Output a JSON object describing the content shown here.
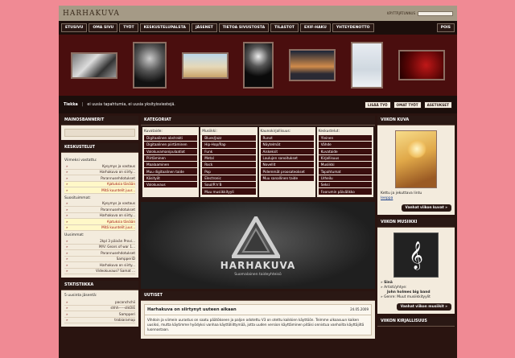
{
  "site": {
    "logo": "HARHAKUVA",
    "login_label": "KÄYTTÄJÄTUNNUS"
  },
  "nav": {
    "items": [
      "ETUSIVU",
      "OMA SIVU",
      "TYÖT",
      "KESKUSTELUPALSTA",
      "JÄSENET",
      "TIETOA SIVUSTOSTA",
      "TILASTOT",
      "EXIF-HAKU",
      "YHTEYDENOTTO"
    ],
    "right": "POIS"
  },
  "info": {
    "day": "Tiekka",
    "text": "ei uusia tapahtumia, ei uusia yksityisviestejä.",
    "buttons": [
      "LISÄÄ TYÖ",
      "OMAT TYÖT",
      "ASETUKSET"
    ]
  },
  "left": {
    "banner_title": "MAINOSBANNERIT",
    "forum_title": "KESKUSTELUT",
    "recent_label": "Viimeksi vastattu:",
    "recent": [
      "Kysymys ja vastaus",
      "Harhakuva on siirty...",
      "Parannusehdotukset",
      "Ajatuksia tänään",
      "Mitä kuuntelit juur..."
    ],
    "popular_label": "Suosituimmat:",
    "popular": [
      "Kysymys ja vastaus",
      "Parannusehdotukset",
      "Harhakuva on siirty...",
      "Ajatuksia tänään",
      "Mitä kuuntelit juur..."
    ],
    "newest_label": "Uusimmat:",
    "newest": [
      "2kpl 3 päivän Provi...",
      "M/V: Gears of war 1...",
      "Parannusehdotukset",
      "SampperiD",
      "Harhakuva on siirty...",
      "Videokuvaus? Samat ..."
    ],
    "stats_title": "STATISTIIKKA",
    "stats_label": "5 uusinta jäsentä:",
    "members": [
      "pacanchchii",
      "shhh-----sIkOiE",
      "Sampperi",
      "trobiaramap"
    ]
  },
  "mid": {
    "cat_title": "KATEGORIAT",
    "cats": [
      {
        "head": "Kuvataide:",
        "items": [
          "Digitaalinen abstrakti",
          "Digitaalinen piirtäminen",
          "Valokuvamanipulaatiot",
          "Piirtäminen",
          "Maalaaminen",
          "Muu digitaalinen taide",
          "Käsityöt",
          "Valokuvaus"
        ]
      },
      {
        "head": "Musiikki:",
        "items": [
          "Blues/Jazz",
          "Hip-Hop/Rap",
          "Funk",
          "Metal",
          "Rock",
          "Pop",
          "Electronic",
          "Soul/R'n'B",
          "Muu musiikkityyli"
        ]
      },
      {
        "head": "Kaunokirjallisuus:",
        "items": [
          "Runot",
          "Näytelmät",
          "Aiskeksit",
          "Laulujen sanoitukset",
          "Novellit",
          "Pidemmät proosateokset",
          "Muu sanallinen taide"
        ]
      },
      {
        "head": "Keskustelut:",
        "items": [
          "Yleinen",
          "Vähde",
          "Kuvataide",
          "Kirjallisuus",
          "Musiikki",
          "Tapahtumat",
          "Urheilu",
          "Seksi",
          "Foorumin päivälikko"
        ]
      }
    ],
    "hero_title": "HARHAKUVA",
    "hero_sub": "Suomalainen taideyhteisö",
    "news_title": "UUTISET",
    "news_item_title": "Harhakuva on siirtynyt uuteen aikaan",
    "news_item_date": "24.05.2009",
    "news_item_body": "Vihdoin ja viimein uurastus on saatu päätökseen ja paljon odotettu V3 on otettu kaikkien käyttöön. Teimme ulkoasuun kaiken uusiksi, mutta käytimme hyödyksi vanhaa käyttöliittymää, jotta uuden version käyttäminen pitäisi onnistua vanhoilta käyttäjiltä luonnostaan."
  },
  "right": {
    "image_title": "VIIKON KUVA",
    "image_caption": "Kettu ja jekuttava lintu",
    "image_author": "Ieeppa",
    "image_button": "Vanhat viikon kuvat »",
    "music_title": "VIIKON MUSIIKKI",
    "music_name": "Sinä",
    "music_artist_label": "Artisti/yhtye:",
    "music_artist": "John holmes big band",
    "music_genre": "Genre: Muut musiikkityylit",
    "music_button": "Vanhat viikon musiikit »",
    "lit_title": "VIIKON KIRJALLISUUS"
  }
}
